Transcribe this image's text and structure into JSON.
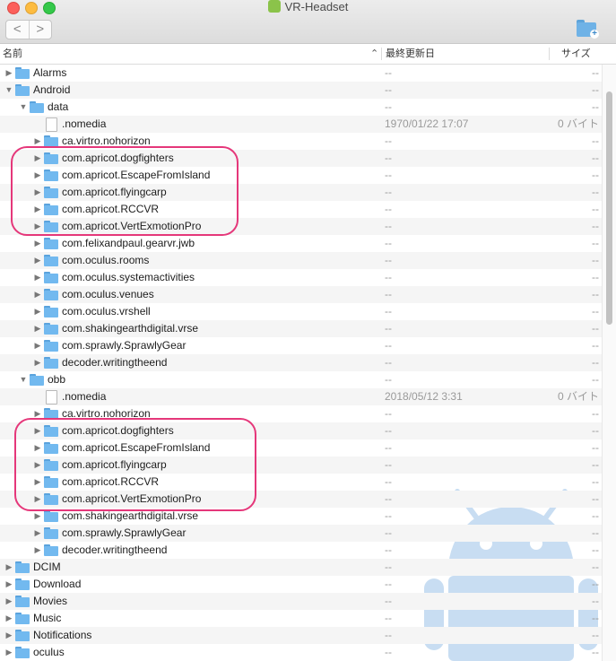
{
  "window": {
    "title": "VR-Headset"
  },
  "toolbar": {
    "back": "<",
    "forward": ">"
  },
  "columns": {
    "name": "名前",
    "date": "最終更新日",
    "size": "サイズ"
  },
  "rows": [
    {
      "name": "Alarms",
      "depth": 0,
      "kind": "folder",
      "expanded": false,
      "date": "--",
      "size": "--"
    },
    {
      "name": "Android",
      "depth": 0,
      "kind": "folder",
      "expanded": true,
      "date": "--",
      "size": "--"
    },
    {
      "name": "data",
      "depth": 1,
      "kind": "folder",
      "expanded": true,
      "date": "--",
      "size": "--"
    },
    {
      "name": ".nomedia",
      "depth": 2,
      "kind": "file",
      "date": "1970/01/22 17:07",
      "size": "0 バイト"
    },
    {
      "name": "ca.virtro.nohorizon",
      "depth": 2,
      "kind": "folder",
      "expanded": false,
      "date": "--",
      "size": "--"
    },
    {
      "name": "com.apricot.dogfighters",
      "depth": 2,
      "kind": "folder",
      "expanded": false,
      "date": "--",
      "size": "--"
    },
    {
      "name": "com.apricot.EscapeFromIsland",
      "depth": 2,
      "kind": "folder",
      "expanded": false,
      "date": "--",
      "size": "--"
    },
    {
      "name": "com.apricot.flyingcarp",
      "depth": 2,
      "kind": "folder",
      "expanded": false,
      "date": "--",
      "size": "--"
    },
    {
      "name": "com.apricot.RCCVR",
      "depth": 2,
      "kind": "folder",
      "expanded": false,
      "date": "--",
      "size": "--"
    },
    {
      "name": "com.apricot.VertExmotionPro",
      "depth": 2,
      "kind": "folder",
      "expanded": false,
      "date": "--",
      "size": "--"
    },
    {
      "name": "com.felixandpaul.gearvr.jwb",
      "depth": 2,
      "kind": "folder",
      "expanded": false,
      "date": "--",
      "size": "--"
    },
    {
      "name": "com.oculus.rooms",
      "depth": 2,
      "kind": "folder",
      "expanded": false,
      "date": "--",
      "size": "--"
    },
    {
      "name": "com.oculus.systemactivities",
      "depth": 2,
      "kind": "folder",
      "expanded": false,
      "date": "--",
      "size": "--"
    },
    {
      "name": "com.oculus.venues",
      "depth": 2,
      "kind": "folder",
      "expanded": false,
      "date": "--",
      "size": "--"
    },
    {
      "name": "com.oculus.vrshell",
      "depth": 2,
      "kind": "folder",
      "expanded": false,
      "date": "--",
      "size": "--"
    },
    {
      "name": "com.shakingearthdigital.vrse",
      "depth": 2,
      "kind": "folder",
      "expanded": false,
      "date": "--",
      "size": "--"
    },
    {
      "name": "com.sprawly.SprawlyGear",
      "depth": 2,
      "kind": "folder",
      "expanded": false,
      "date": "--",
      "size": "--"
    },
    {
      "name": "decoder.writingtheend",
      "depth": 2,
      "kind": "folder",
      "expanded": false,
      "date": "--",
      "size": "--"
    },
    {
      "name": "obb",
      "depth": 1,
      "kind": "folder",
      "expanded": true,
      "date": "--",
      "size": "--"
    },
    {
      "name": ".nomedia",
      "depth": 2,
      "kind": "file",
      "date": "2018/05/12 3:31",
      "size": "0 バイト"
    },
    {
      "name": "ca.virtro.nohorizon",
      "depth": 2,
      "kind": "folder",
      "expanded": false,
      "date": "--",
      "size": "--"
    },
    {
      "name": "com.apricot.dogfighters",
      "depth": 2,
      "kind": "folder",
      "expanded": false,
      "date": "--",
      "size": "--"
    },
    {
      "name": "com.apricot.EscapeFromIsland",
      "depth": 2,
      "kind": "folder",
      "expanded": false,
      "date": "--",
      "size": "--"
    },
    {
      "name": "com.apricot.flyingcarp",
      "depth": 2,
      "kind": "folder",
      "expanded": false,
      "date": "--",
      "size": "--"
    },
    {
      "name": "com.apricot.RCCVR",
      "depth": 2,
      "kind": "folder",
      "expanded": false,
      "date": "--",
      "size": "--"
    },
    {
      "name": "com.apricot.VertExmotionPro",
      "depth": 2,
      "kind": "folder",
      "expanded": false,
      "date": "--",
      "size": "--"
    },
    {
      "name": "com.shakingearthdigital.vrse",
      "depth": 2,
      "kind": "folder",
      "expanded": false,
      "date": "--",
      "size": "--"
    },
    {
      "name": "com.sprawly.SprawlyGear",
      "depth": 2,
      "kind": "folder",
      "expanded": false,
      "date": "--",
      "size": "--"
    },
    {
      "name": "decoder.writingtheend",
      "depth": 2,
      "kind": "folder",
      "expanded": false,
      "date": "--",
      "size": "--"
    },
    {
      "name": "DCIM",
      "depth": 0,
      "kind": "folder",
      "expanded": false,
      "date": "--",
      "size": "--"
    },
    {
      "name": "Download",
      "depth": 0,
      "kind": "folder",
      "expanded": false,
      "date": "--",
      "size": "--"
    },
    {
      "name": "Movies",
      "depth": 0,
      "kind": "folder",
      "expanded": false,
      "date": "--",
      "size": "--"
    },
    {
      "name": "Music",
      "depth": 0,
      "kind": "folder",
      "expanded": false,
      "date": "--",
      "size": "--"
    },
    {
      "name": "Notifications",
      "depth": 0,
      "kind": "folder",
      "expanded": false,
      "date": "--",
      "size": "--"
    },
    {
      "name": "oculus",
      "depth": 0,
      "kind": "folder",
      "expanded": false,
      "date": "--",
      "size": "--"
    }
  ],
  "colors": {
    "highlight": "#e5377a",
    "folder": "#72b9ef",
    "android": "#9cc3e8"
  }
}
